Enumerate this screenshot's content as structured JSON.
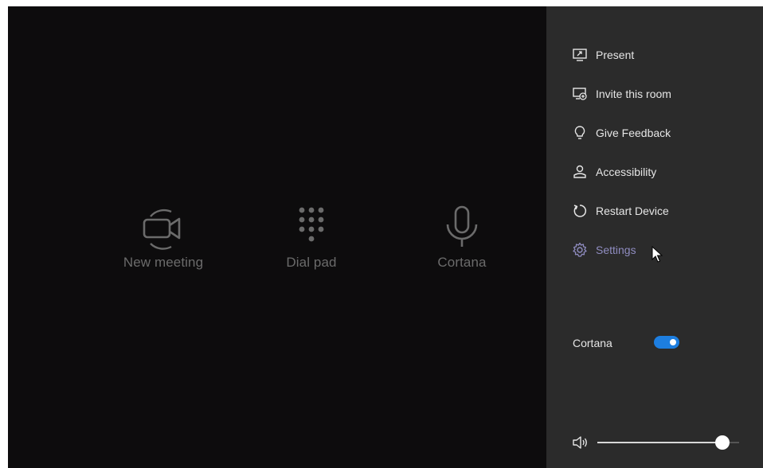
{
  "main": {
    "buttons": [
      {
        "label": "New meeting",
        "icon": "video-camera-icon"
      },
      {
        "label": "Dial pad",
        "icon": "dial-pad-icon"
      },
      {
        "label": "Cortana",
        "icon": "microphone-icon"
      }
    ]
  },
  "panel": {
    "menu": [
      {
        "label": "Present",
        "icon": "present-screen-icon"
      },
      {
        "label": "Invite this room",
        "icon": "invite-room-icon"
      },
      {
        "label": "Give Feedback",
        "icon": "lightbulb-icon"
      },
      {
        "label": "Accessibility",
        "icon": "accessibility-icon"
      },
      {
        "label": "Restart Device",
        "icon": "restart-icon"
      },
      {
        "label": "Settings",
        "icon": "gear-icon",
        "state": "hovered"
      }
    ],
    "cortana_toggle": {
      "label": "Cortana",
      "on": true
    },
    "volume": {
      "icon": "speaker-icon",
      "level": 0.88
    }
  },
  "colors": {
    "background": "#0d0c0d",
    "panel": "#2b2b2b",
    "accent_toggle": "#1d7ee0",
    "hover_text": "#8f8cc0",
    "home_label": "#6b6b6b"
  }
}
